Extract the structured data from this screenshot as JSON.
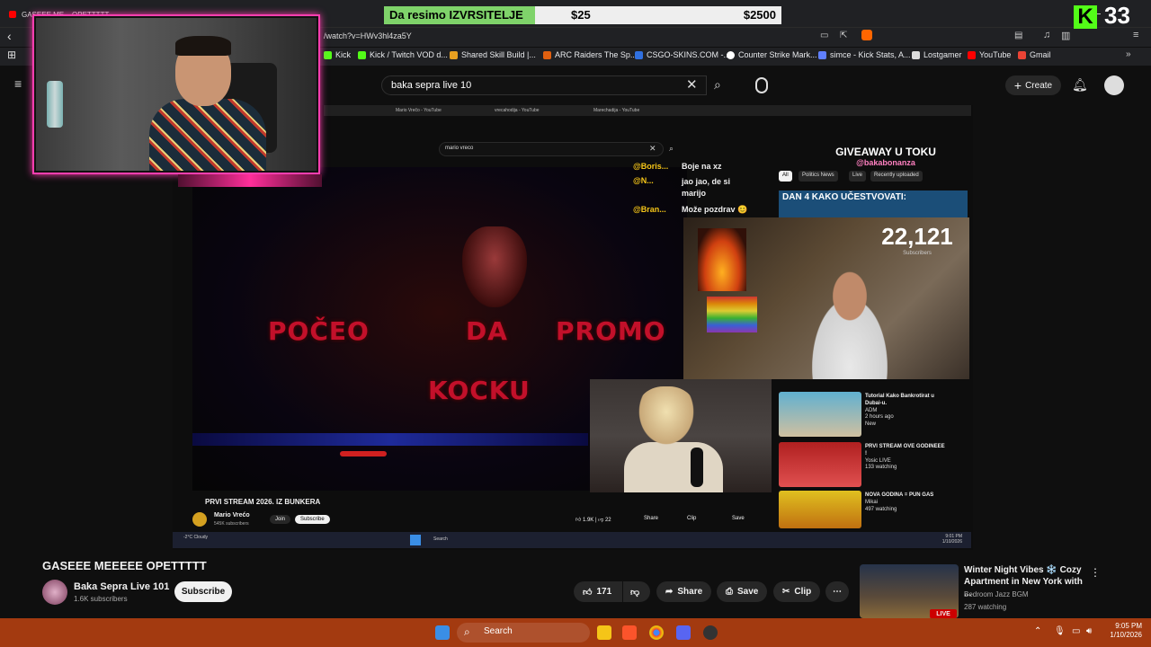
{
  "browser": {
    "tab_title": "GASEEE ME... OPETTTTT",
    "url": "/watch?v=HWv3hl4za5Y",
    "bookmarks": [
      "Kick",
      "Kick / Twitch VOD d...",
      "Shared Skill Build |...",
      "ARC Raiders The Sp...",
      "CSGO-SKINS.COM -...",
      "Counter Strike Mark...",
      "simce - Kick Stats, A...",
      "Lostgamer",
      "YouTube",
      "Gmail"
    ]
  },
  "youtube_header": {
    "search_value": "baka sepra live 10",
    "create_label": "Create"
  },
  "bet_overlay": {
    "label": "Da resimo IZVRSITELJE",
    "min": "$25",
    "max": "$2500"
  },
  "kick_overlay": {
    "logo": "K",
    "count": "33"
  },
  "inner_screen": {
    "search_value": "mario vreco",
    "tabs": [
      "Mario Vrečo - YouTube",
      "vrecahodija - YouTube",
      "Marechadija - YouTube"
    ],
    "headline_words": [
      "POČEO",
      "DA",
      "PROMO",
      "KOCKU"
    ],
    "chat": [
      {
        "user": "@Boris...",
        "msg": "Boje na xz"
      },
      {
        "user": "@N...",
        "msg": "jao jao, de si marijo"
      },
      {
        "user": "@Bran...",
        "msg": "Može pozdrav 😊"
      }
    ],
    "giveaway_title": "GIVEAWAY U TOKU",
    "giveaway_handle": "@bakabonanza",
    "dan_label": "DAN 4 KAKO UČESTVOVATI:",
    "subscriber_count": "22,121",
    "subscriber_label": "Subscribers",
    "chips": [
      "All",
      "Politics News",
      "Live",
      "Recently uploaded"
    ],
    "side_videos": [
      {
        "title": "Tutorial Kako Bankrotirat u Dubai-u.",
        "channel": "ADM",
        "meta": "2 hours ago",
        "badge": "New",
        "duration": "39:04"
      },
      {
        "title": "PRVI STREAM OVE GODINEEE !",
        "channel": "Yosic LIVE",
        "meta": "133 watching",
        "badge": "LIVE"
      },
      {
        "title": "NOVA GODINA = PUN GAS",
        "channel": "Mikai",
        "meta": "497 watching",
        "badge": "LIVE"
      }
    ],
    "video_title": "PRVI STREAM 2026. IZ BUNKERA",
    "channel_name": "Mario Vrećo",
    "channel_subs": "545K subscribers",
    "join_label": "Join",
    "subscribe_label": "Subscribe",
    "likes": "1.9K",
    "dislikes": "22",
    "share_label": "Share",
    "clip_label": "Clip",
    "save_label": "Save",
    "weather": "-2°C Cloudy",
    "taskbar_search": "Search",
    "clock_time": "9:01 PM",
    "clock_date": "1/10/2026"
  },
  "video": {
    "title": "GASEEE MEEEEE OPETTTTT",
    "channel": "Baka Sepra Live 101",
    "subscribers": "1.6K subscribers",
    "subscribe_label": "Subscribe",
    "likes": "171",
    "share_label": "Share",
    "save_label": "Save",
    "clip_label": "Clip"
  },
  "recommended": {
    "title": "Winter Night Vibes ❄️ Cozy Apartment in New York with ...",
    "channel": "Bedroom Jazz BGM",
    "watching": "287 watching",
    "live_label": "LIVE"
  },
  "taskbar": {
    "search_label": "Search",
    "time": "9:05 PM",
    "date": "1/10/2026"
  }
}
